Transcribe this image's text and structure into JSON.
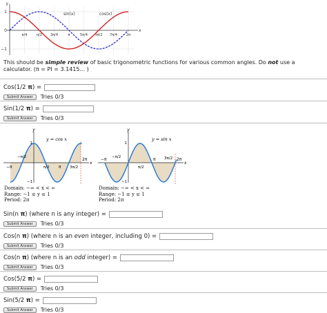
{
  "top_plot": {
    "legend_sin": "sin(x)",
    "legend_cos": "cos(x)",
    "axis_y": "y",
    "axis_x": "x",
    "y_ticks": [
      "1",
      "0",
      "−1"
    ],
    "x_ticks": [
      "π/4",
      "π/2",
      "3π/4",
      "π",
      "5π/4",
      "3π/2",
      "7π/4",
      "2π"
    ],
    "colors": {
      "sin": "#3a3acc",
      "cos": "#d42020"
    }
  },
  "intro": {
    "before": "This should be ",
    "emph": "simple review",
    "after": " of basic trigonometric functions for various common angles. Do ",
    "not": "not",
    "after2": " use a calculator. (π = PI = 3.1415... )"
  },
  "common": {
    "submit_label": "Submit Answer",
    "tries": "Tries 0/3"
  },
  "questions": [
    {
      "pre": "Cos(1/2 ",
      "var": "π",
      "post": ") ="
    },
    {
      "pre": "Sin(1/2 ",
      "var": "π",
      "post": ") ="
    },
    {
      "pre": "Sin(n ",
      "var": "π",
      "post": ") (where n is any integer) ="
    },
    {
      "pre": "Cos(n ",
      "var": "π",
      "post": ") (where n is an ",
      "em": "even",
      "post2": " integer, including 0) ="
    },
    {
      "pre": "Cos(n ",
      "var": "π",
      "post": ") (where n is an ",
      "em": "odd",
      "post2": " integer) ="
    },
    {
      "pre": "Cos(5/2 ",
      "var": "π",
      "post": ") ="
    },
    {
      "pre": "Sin(5/2 ",
      "var": "π",
      "post": ") ="
    }
  ],
  "graphs": {
    "cos": {
      "title": "y = cos x",
      "domain": "Domain: −∞ < x < ∞",
      "range": "Range: −1 ≤ y ≤ 1",
      "period": "Period: 2π"
    },
    "sin": {
      "title": "y = sin x",
      "domain": "Domain: −∞ < x < ∞",
      "range": "Range: −1 ≤ y ≤ 1",
      "period": "Period: 2π"
    },
    "axis_x": "x",
    "axis_y": "y",
    "tick_labels": [
      "−π",
      "π/2",
      "π",
      "3π/2",
      "2π"
    ],
    "tick_labels_upper": [
      "−π/2"
    ],
    "y_labels": [
      "1",
      "−1"
    ],
    "colors": {
      "curve": "#2a7bd4",
      "fill": "#e8dcc4",
      "dashed": "#e05050"
    }
  }
}
